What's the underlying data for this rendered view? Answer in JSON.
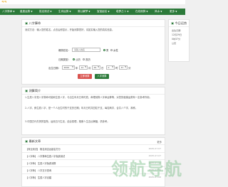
{
  "site": {
    "logo": "ㅋㅋ"
  },
  "nav": {
    "items": [
      {
        "label": "八字算命"
      },
      {
        "label": "星座运势"
      },
      {
        "label": "姓名测试"
      },
      {
        "label": "生肖运势"
      },
      {
        "label": "周公解梦"
      },
      {
        "label": "宝宝起名"
      },
      {
        "label": "塔罗占卜"
      },
      {
        "label": "在线测算"
      },
      {
        "label": "风水"
      },
      {
        "label": "更多"
      }
    ]
  },
  "form": {
    "title": "八字算命",
    "desc": "测试方法：输入您的姓名，点击后即显示，开始测算您好，请如实输入您的真实信息。",
    "name_label": "爆笑姓名：",
    "name_placeholder": "请输入姓名",
    "gender_male": "男",
    "gender_female": "女性",
    "calendar_label": "日期类型：",
    "cal_solar": "公历",
    "cal_lunar": "农历",
    "birth_label": "出生日期：",
    "year": "2000",
    "year_unit": "年",
    "month": "12",
    "month_unit": "月",
    "day": "29",
    "day_unit": "日",
    "hour": "0",
    "hour_unit": "时",
    "minute": "37",
    "minute_unit": "分",
    "submit": "立即测算",
    "reset": "八字测算"
  },
  "intro": {
    "title": "测算简介",
    "para1": "1.生辰八字是八字算命可能和生辰八字、与出生年月日有时辰，命理测算八字命运等等，对您的健康运势有一定参考作用。",
    "para2": "2.八字，即生辰八字，是一个人出生时的干支历日期；年月日时共四柱干支，每柱两字，合共八个字，故称。",
    "para3": "3.中国古代先贤的智慧，运用五行生克，结合易理，推断人生吉凶祸福，供参考。"
  },
  "latest": {
    "title": "最新文章",
    "more": "更多",
    "rows": [
      {
        "title": "【商业测试】 取名测吉凶起名打分",
        "date": "2025-07-07"
      },
      {
        "title": "【八字命】 八字算命生辰八字免费测试",
        "date": "2025-07-07"
      },
      {
        "title": "【八字命】 生辰八字免费测算",
        "date": "2025-07-06"
      },
      {
        "title": "【八字命】 八字五行查询",
        "date": "2025-07-06"
      },
      {
        "title": "【八字命】 生辰八字合婚",
        "date": "2025-07-06"
      }
    ]
  },
  "side": {
    "title": "今日运势",
    "lines": [
      "出生日期",
      "12月29日",
      "0时37分",
      "公历"
    ]
  },
  "watermark": "领航导航"
}
